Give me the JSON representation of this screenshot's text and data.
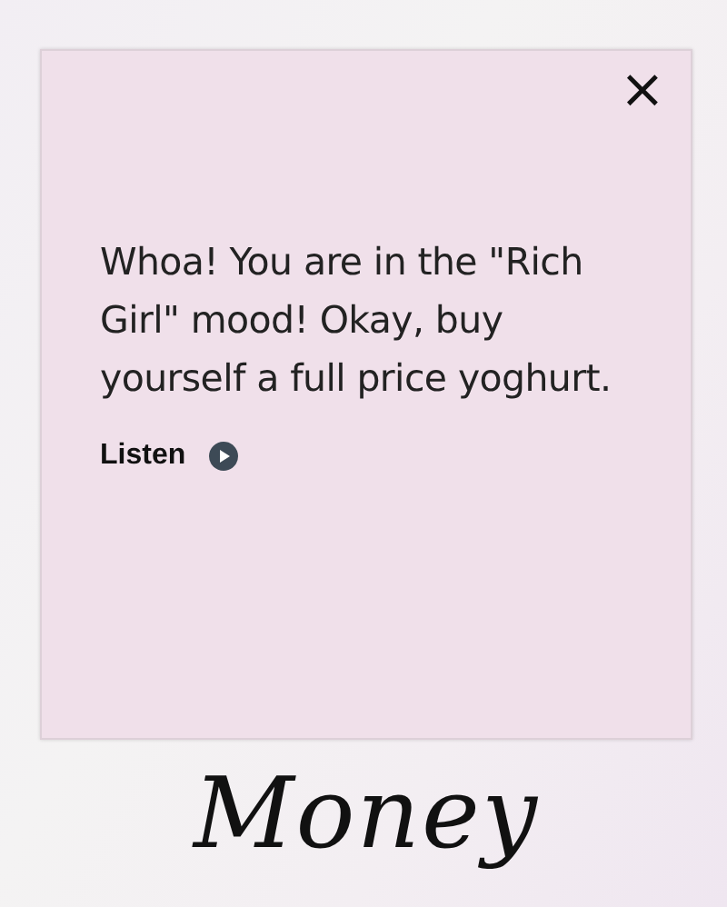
{
  "card": {
    "close": "×",
    "message": "Whoa! You are in the \"Rich Girl\" mood! Okay, buy yourself a full price yoghurt.",
    "listen": "Listen"
  },
  "caption": "Money"
}
